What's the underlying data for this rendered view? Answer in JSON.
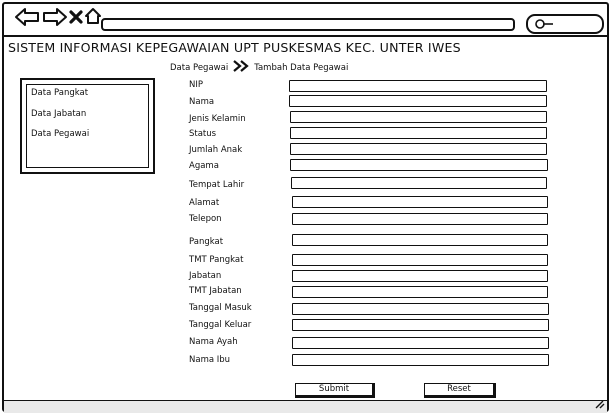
{
  "app": {
    "title": "SISTEM INFORMASI KEPEGAWAIAN UPT PUSKESMAS KEC. UNTER IWES"
  },
  "toolbar": {
    "icons": [
      "back-arrow-icon",
      "forward-arrow-icon",
      "close-icon",
      "home-icon",
      "search-icon"
    ]
  },
  "breadcrumb": {
    "parent": "Data Pegawai",
    "separator_icon": "double-chevron-right-icon",
    "current": "Tambah Data Pegawai"
  },
  "sidebar": {
    "items": [
      {
        "label": "Data Pangkat"
      },
      {
        "label": "Data Jabatan"
      },
      {
        "label": "Data Pegawai"
      }
    ]
  },
  "form": {
    "fields": [
      {
        "label": "NIP",
        "value": ""
      },
      {
        "label": "Nama",
        "value": ""
      },
      {
        "label": "Jenis Kelamin",
        "value": ""
      },
      {
        "label": "Status",
        "value": ""
      },
      {
        "label": "Jumlah Anak",
        "value": ""
      },
      {
        "label": "Agama",
        "value": ""
      },
      {
        "label": "Tempat Lahir",
        "value": ""
      },
      {
        "label": "Alamat",
        "value": ""
      },
      {
        "label": "Telepon",
        "value": ""
      },
      {
        "label": "Pangkat",
        "value": ""
      },
      {
        "label": "TMT Pangkat",
        "value": ""
      },
      {
        "label": "Jabatan",
        "value": ""
      },
      {
        "label": "TMT Jabatan",
        "value": ""
      },
      {
        "label": "Tanggal Masuk",
        "value": ""
      },
      {
        "label": "Tanggal Keluar",
        "value": ""
      },
      {
        "label": "Nama Ayah",
        "value": ""
      },
      {
        "label": "Nama Ibu",
        "value": ""
      }
    ],
    "submit_label": "Submit",
    "reset_label": "Reset"
  }
}
